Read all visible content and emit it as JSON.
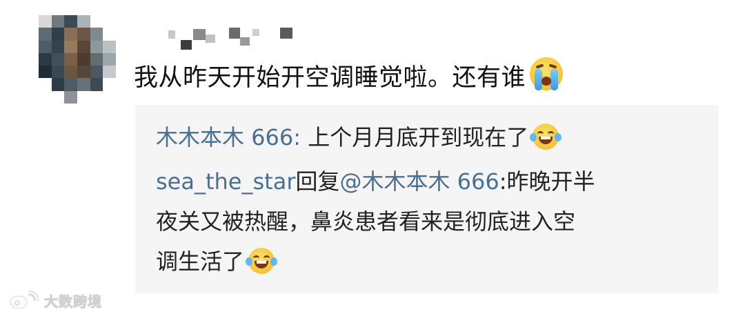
{
  "comment": {
    "text": "我从昨天开始开空调睡觉啦。还有谁",
    "emoji": "crying-face-icon"
  },
  "replies": [
    {
      "user": "木木本木 666",
      "separator": ": ",
      "text": "上个月月底开到现在了",
      "emoji": "laughing-crying-icon"
    },
    {
      "user": "sea_the_star",
      "reply_word": "回复",
      "mention": "@木木本木 666",
      "separator": ":",
      "text_line1": "昨晚开半",
      "text_line2": "夜关又被热醒，鼻炎患者看来是彻底进入空",
      "text_line3": "调生活了",
      "emoji": "laughing-crying-icon"
    }
  ],
  "watermark": {
    "text": "大数跨境",
    "icon": "weibo-logo-icon"
  },
  "colors": {
    "username": "#4a6f96",
    "text": "#222222",
    "reply_background": "#f5f5f5"
  }
}
